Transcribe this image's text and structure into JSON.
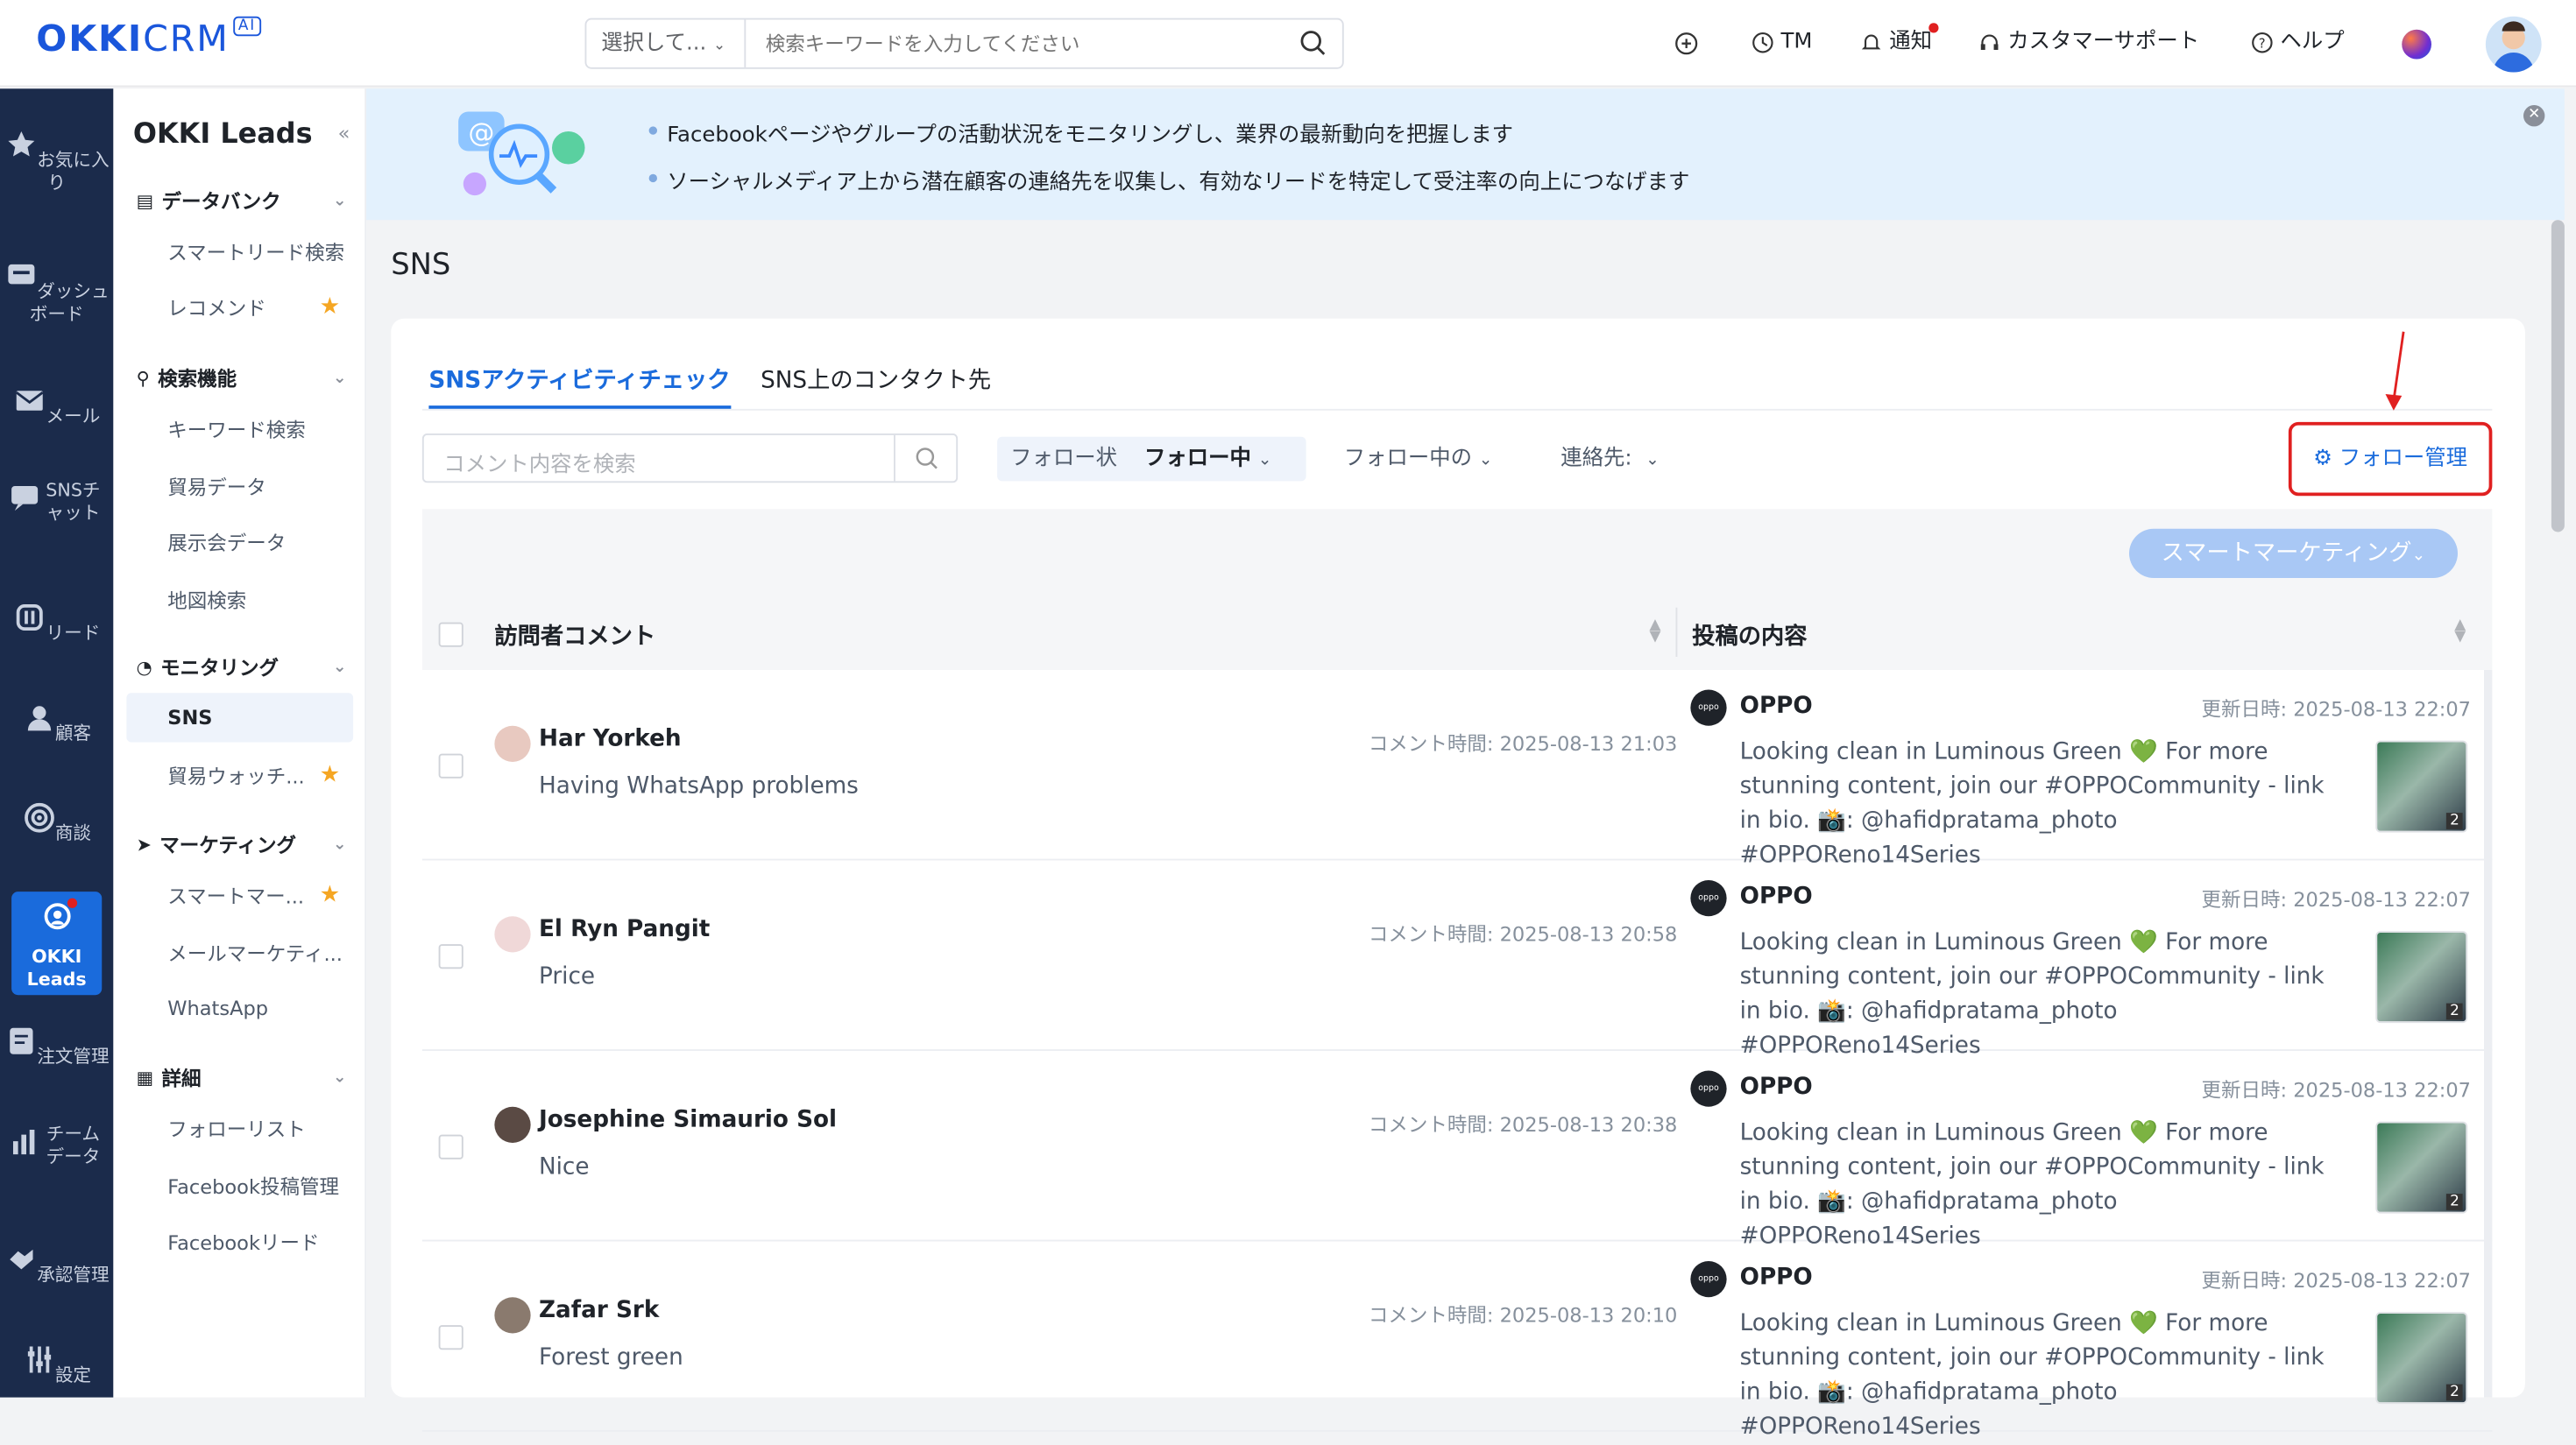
{
  "topbar": {
    "logo_main": "OKKI",
    "logo_crm": "CRM",
    "logo_ai": "AI",
    "search_select": "選択して...",
    "search_placeholder": "検索キーワードを入力してください",
    "nav": {
      "tm": "TM",
      "notify": "通知",
      "support": "カスタマーサポート",
      "help": "ヘルプ"
    }
  },
  "left_nav": [
    {
      "label": "お気に入り",
      "icon": "star-icon"
    },
    {
      "label": "ダッシュボード",
      "icon": "dashboard-icon"
    },
    {
      "label": "メール",
      "icon": "mail-icon"
    },
    {
      "label": "SNSチャット",
      "icon": "chat-icon"
    },
    {
      "label": "リード",
      "icon": "lead-icon"
    },
    {
      "label": "顧客",
      "icon": "customer-icon"
    },
    {
      "label": "商談",
      "icon": "target-icon"
    },
    {
      "label": "OKKI Leads",
      "icon": "okki-leads-icon",
      "active": true
    },
    {
      "label": "注文管理",
      "icon": "order-icon"
    },
    {
      "label": "チームデータ",
      "icon": "chart-icon"
    },
    {
      "label": "承認管理",
      "icon": "approve-icon"
    },
    {
      "label": "設定",
      "icon": "settings-icon"
    }
  ],
  "side2": {
    "title": "OKKI Leads",
    "collapse": "«",
    "sections": {
      "databank": "データバンク",
      "search": "検索機能",
      "monitoring": "モニタリング",
      "marketing": "マーケティング",
      "detail": "詳細"
    },
    "items": {
      "smart_lead": "スマートリード検索",
      "recommend": "レコメンド",
      "keyword": "キーワード検索",
      "trade": "貿易データ",
      "expo": "展示会データ",
      "map": "地図検索",
      "sns": "SNS",
      "trade_watch": "貿易ウォッチ...",
      "smart_mkt": "スマートマー...",
      "mail_mkt": "メールマーケティ...",
      "whatsapp": "WhatsApp",
      "follow_list": "フォローリスト",
      "fb_post": "Facebook投稿管理",
      "fb_lead": "Facebookリード"
    }
  },
  "banner": {
    "line1": "Facebookページやグループの活動状況をモニタリングし、業界の最新動向を把握します",
    "line2": "ソーシャルメディア上から潜在顧客の連絡先を収集し、有効なリードを特定して受注率の向上につなげます"
  },
  "main": {
    "title": "SNS",
    "tabs": [
      "SNSアクティビティチェック",
      "SNS上のコンタクト先"
    ],
    "comment_search_placeholder": "コメント内容を検索",
    "filter_follow_label": "フォロー状",
    "filter_follow_value": "フォロー中",
    "filter_following": "フォロー中の",
    "filter_contact": "連絡先:",
    "follow_manage": "フォロー管理",
    "smart_marketing": "スマートマーケティング",
    "col_comment": "訪問者コメント",
    "col_post": "投稿の内容"
  },
  "rows": [
    {
      "name": "Har Yorkeh",
      "comment": "Having WhatsApp problems",
      "time": "コメント時間: 2025-08-13 21:03",
      "brand": "OPPO",
      "updated": "更新日時:  2025-08-13 22:07",
      "post": "Looking clean in Luminous Green 💚 For more stunning content, join our #OPPOCommunity - link in bio. 📸: @hafidpratama_photo #OPPOReno14Series",
      "img_count": "2"
    },
    {
      "name": "El Ryn Pangit",
      "comment": "Price",
      "time": "コメント時間: 2025-08-13 20:58",
      "brand": "OPPO",
      "updated": "更新日時:  2025-08-13 22:07",
      "post": "Looking clean in Luminous Green 💚 For more stunning content, join our #OPPOCommunity - link in bio. 📸: @hafidpratama_photo #OPPOReno14Series",
      "img_count": "2"
    },
    {
      "name": "Josephine Simaurio Sol",
      "comment": "Nice",
      "time": "コメント時間: 2025-08-13 20:38",
      "brand": "OPPO",
      "updated": "更新日時:  2025-08-13 22:07",
      "post": "Looking clean in Luminous Green 💚 For more stunning content, join our #OPPOCommunity - link in bio. 📸: @hafidpratama_photo #OPPOReno14Series",
      "img_count": "2"
    },
    {
      "name": "Zafar Srk",
      "comment": "Forest green",
      "time": "コメント時間: 2025-08-13 20:10",
      "brand": "OPPO",
      "updated": "更新日時:  2025-08-13 22:07",
      "post": "Looking clean in Luminous Green 💚 For more stunning content, join our #OPPOCommunity - link in bio. 📸: @hafidpratama_photo #OPPOReno14Series",
      "img_count": "2"
    }
  ]
}
